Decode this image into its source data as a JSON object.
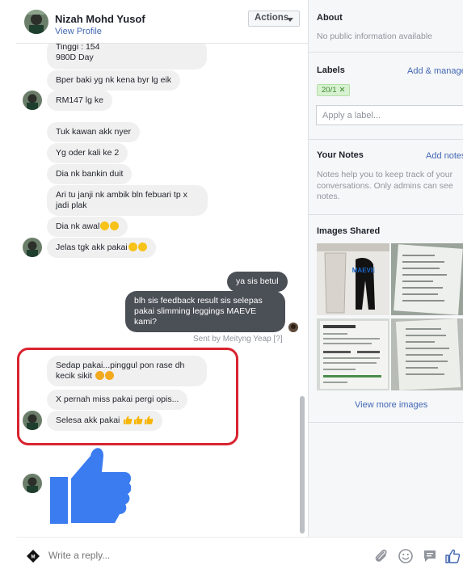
{
  "header": {
    "contact_name": "Nizah Mohd Yusof",
    "view_profile": "View Profile",
    "actions_label": "Actions"
  },
  "messages": [
    {
      "text": "Tinggi : 154\n980D Day",
      "line1": "Tinggi : 154",
      "line2": "980D Day",
      "direction": "in"
    },
    {
      "text": "Bper baki yg nk kena byr lg eik",
      "direction": "in"
    },
    {
      "text": "RM147 lg ke",
      "direction": "in"
    },
    {
      "text": "Tuk kawan akk nyer",
      "direction": "in"
    },
    {
      "text": "Yg oder kali ke 2",
      "direction": "in"
    },
    {
      "text": "Dia nk bankin duit",
      "direction": "in"
    },
    {
      "text": "Ari tu janji nk ambik bln febuari tp x jadi plak",
      "direction": "in"
    },
    {
      "text": "Dia nk awal",
      "direction": "in",
      "emoji": "laughing-emoji x2"
    },
    {
      "text": "Jelas tgk akk pakai",
      "direction": "in",
      "emoji": "laughing-emoji x2"
    },
    {
      "text": "ya sis betul",
      "direction": "out"
    },
    {
      "text": "blh sis feedback result sis selepas pakai slimming leggings MAEVE kami?",
      "direction": "out"
    },
    {
      "text": "Sedap pakai...pinggul pon rase dh kecik sikit",
      "direction": "in",
      "emoji": "smile-emoji x2"
    },
    {
      "text": "X pernah miss pakai pergi opis...",
      "direction": "in"
    },
    {
      "text": "Selesa akk pakai",
      "direction": "in",
      "emoji": "thumbs-up-emoji x3"
    }
  ],
  "sent_by": "Sent by Meityng Yeap",
  "sent_by_help": "[?]",
  "composer": {
    "placeholder": "Write a reply...",
    "icons": [
      "attachment-icon",
      "emoji-icon",
      "saved-reply-icon",
      "like-icon"
    ]
  },
  "sidebar": {
    "about_title": "About",
    "about_text": "No public information available",
    "labels_title": "Labels",
    "add_manage": "Add & manage",
    "label_chip": "20/1",
    "label_placeholder": "Apply a label...",
    "notes_title": "Your Notes",
    "add_notes": "Add notes",
    "notes_text": "Notes help you to keep track of your conversations. Only admins can see notes.",
    "images_title": "Images Shared",
    "view_more": "View more images",
    "image_tiles": [
      {
        "caption": "MAEVE",
        "kind": "leggings-product-photo"
      },
      {
        "kind": "document-photo"
      },
      {
        "kind": "document-photo"
      },
      {
        "kind": "document-photo"
      }
    ]
  },
  "colors": {
    "accent": "#4267b2",
    "outgoing_bubble": "#4b4f56",
    "incoming_bubble": "#f1f0f0",
    "highlight_ring": "#d9232f",
    "like_blue": "#3b7cf0"
  }
}
